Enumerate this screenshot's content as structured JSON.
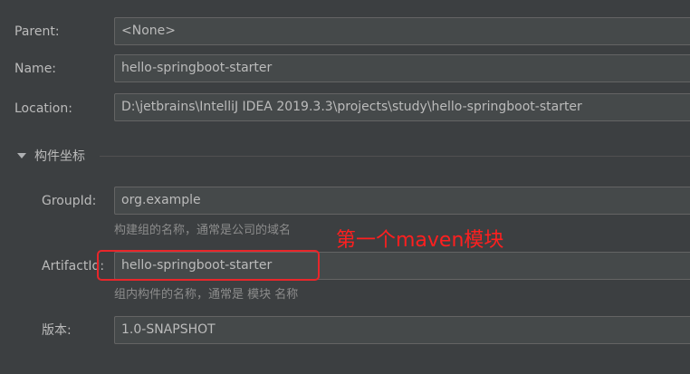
{
  "form": {
    "parent": {
      "label": "Parent:",
      "value": "<None>"
    },
    "name": {
      "label": "Name:",
      "value": "hello-springboot-starter"
    },
    "location": {
      "label": "Location:",
      "value": "D:\\jetbrains\\IntelliJ IDEA 2019.3.3\\projects\\study\\hello-springboot-starter"
    }
  },
  "artifact_section": {
    "title": "构件坐标",
    "group_id": {
      "label": "GroupId:",
      "value": "org.example",
      "hint": "构建组的名称，通常是公司的域名"
    },
    "artifact_id": {
      "label": "ArtifactId:",
      "value": "hello-springboot-starter",
      "hint": "组内构件的名称，通常是 模块 名称"
    },
    "version": {
      "label": "版本:",
      "value": "1.0-SNAPSHOT"
    }
  },
  "annotation": {
    "text": "第一个maven模块",
    "color": "#ff1f1f"
  },
  "colors": {
    "background": "#3c3f41",
    "field_background": "#45494a",
    "field_border": "#646464",
    "text": "#bbbbbb",
    "hint_text": "#8c8c8c"
  },
  "icons": {
    "section_toggle": "triangle-down-icon"
  }
}
